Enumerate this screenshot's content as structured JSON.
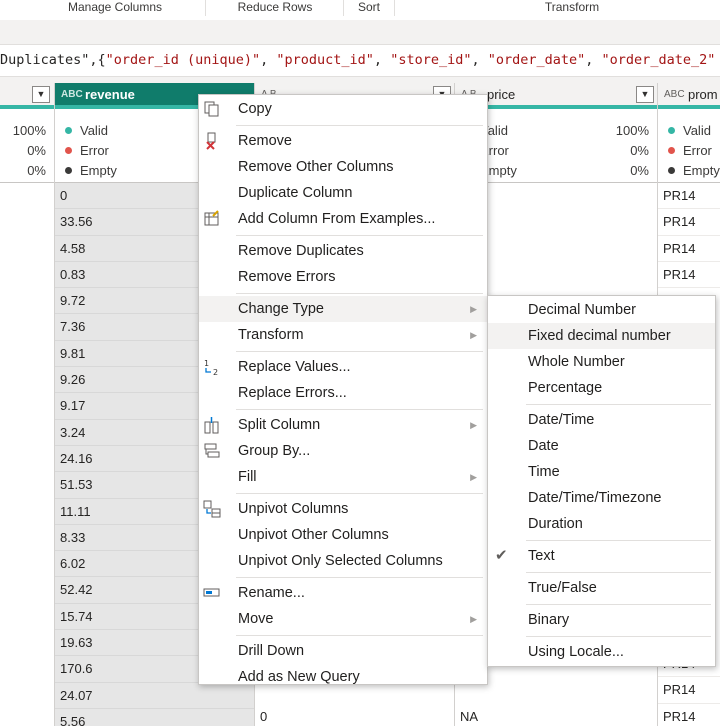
{
  "ribbon": {
    "groups": [
      "Manage Columns",
      "Reduce Rows",
      "Sort",
      "Transform"
    ]
  },
  "formula": {
    "prefix": "Duplicates\",{",
    "tokens": [
      "\"order_id (unique)\"",
      "\"product_id\"",
      "\"store_id\"",
      "\"order_date\"",
      "\"order_date_2\""
    ]
  },
  "columns": {
    "prev": {
      "valid_pct": "100%",
      "error_pct": "0%",
      "empty_pct": "0%"
    },
    "revenue": {
      "type_icon": "ABC",
      "name": "revenue",
      "valid": "Valid",
      "error": "Error",
      "empty": "Empty",
      "cells": [
        "0",
        "33.56",
        "4.58",
        "0.83",
        "9.72",
        "7.36",
        "9.81",
        "9.26",
        "9.17",
        "3.24",
        "24.16",
        "51.53",
        "11.11",
        "8.33",
        "6.02",
        "52.42",
        "15.74",
        "19.63",
        "170.6",
        "24.07",
        "5.56"
      ]
    },
    "next": {
      "type_icon": "A B",
      "name": "",
      "cells_tail": [
        "0",
        "0"
      ]
    },
    "price": {
      "type_icon": "A B",
      "name": "price",
      "valid": "Valid",
      "error": "Error",
      "empty": "Empty",
      "valid_pct": "100%",
      "error_pct": "0%",
      "empty_pct": "0%",
      "cells_tail": [
        "NA",
        "NA"
      ]
    },
    "promo": {
      "type_icon": "ABC",
      "name": "prom",
      "valid": "Valid",
      "error": "Error",
      "empty": "Empty",
      "cells": [
        "PR14",
        "PR14",
        "PR14",
        "PR14"
      ],
      "cells_tail": [
        "PR14",
        "PR14",
        "PR14"
      ]
    }
  },
  "context_menu": {
    "items": [
      "Copy",
      "Remove",
      "Remove Other Columns",
      "Duplicate Column",
      "Add Column From Examples...",
      "Remove Duplicates",
      "Remove Errors",
      "Change Type",
      "Transform",
      "Replace Values...",
      "Replace Errors...",
      "Split Column",
      "Group By...",
      "Fill",
      "Unpivot Columns",
      "Unpivot Other Columns",
      "Unpivot Only Selected Columns",
      "Rename...",
      "Move",
      "Drill Down",
      "Add as New Query"
    ]
  },
  "type_submenu": {
    "items": [
      "Decimal Number",
      "Fixed decimal number",
      "Whole Number",
      "Percentage",
      "Date/Time",
      "Date",
      "Time",
      "Date/Time/Timezone",
      "Duration",
      "Text",
      "True/False",
      "Binary",
      "Using Locale..."
    ],
    "checked": "Text",
    "highlighted": "Fixed decimal number"
  },
  "colors": {
    "selected_header": "#107c6b",
    "quality_bar": "#35b6a5",
    "valid": "#35b6a5",
    "error": "#e1544c",
    "empty": "#3b3a39"
  }
}
